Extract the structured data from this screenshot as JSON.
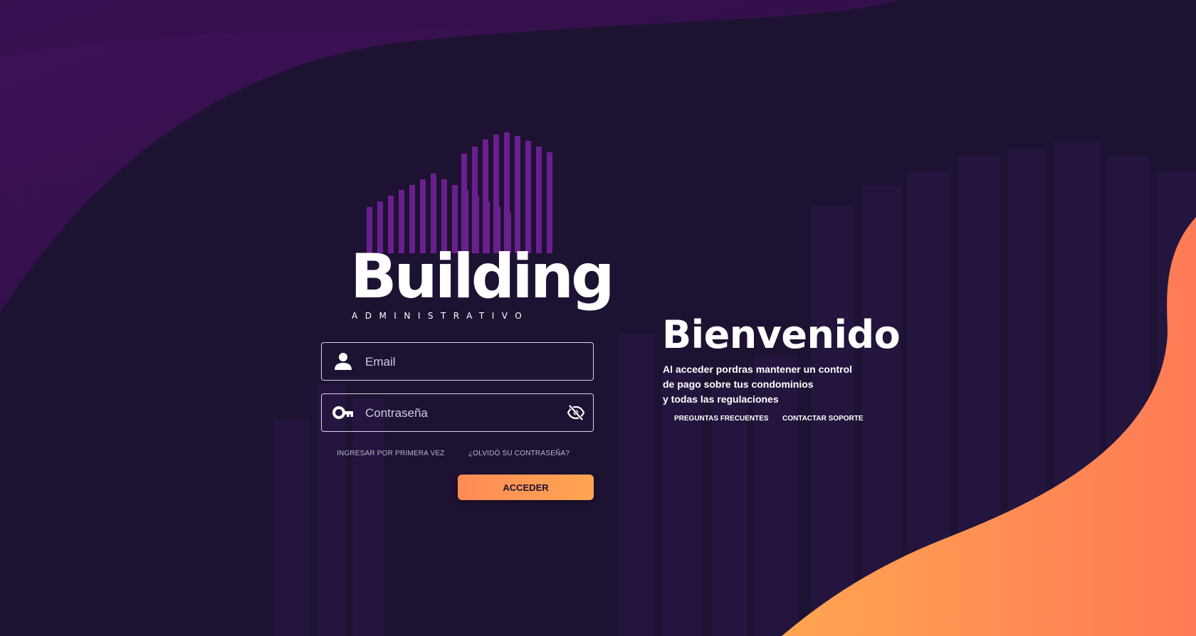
{
  "login": {
    "email_placeholder": "Email",
    "password_placeholder": "Contraseña",
    "first_time_link": "INGRESAR POR PRIMERA VEZ",
    "forgot_link": "¿OLVIDÓ SU CONTRASEÑA?",
    "submit_label": "ACCEDER"
  },
  "logo": {
    "word": "Building",
    "sub": "ADMINISTRATIVO"
  },
  "welcome": {
    "title": "Bienvenido",
    "desc_lines": [
      "Al acceder pordras mantener un control",
      "de pago sobre tus condominios",
      "y todas las regulaciones"
    ],
    "faq_link": "PREGUNTAS FRECUENTES",
    "support_link": "CONTACTAR SOPORTE"
  },
  "icons": {
    "email": "user-icon",
    "password": "key-icon",
    "toggle": "eye-off-icon"
  },
  "colors": {
    "background": "#1e1232",
    "purple_accent": "#3a1254",
    "orange_start": "#ffa552",
    "orange_end": "#ff7a55",
    "logo_bars": "#6a1f8e"
  }
}
